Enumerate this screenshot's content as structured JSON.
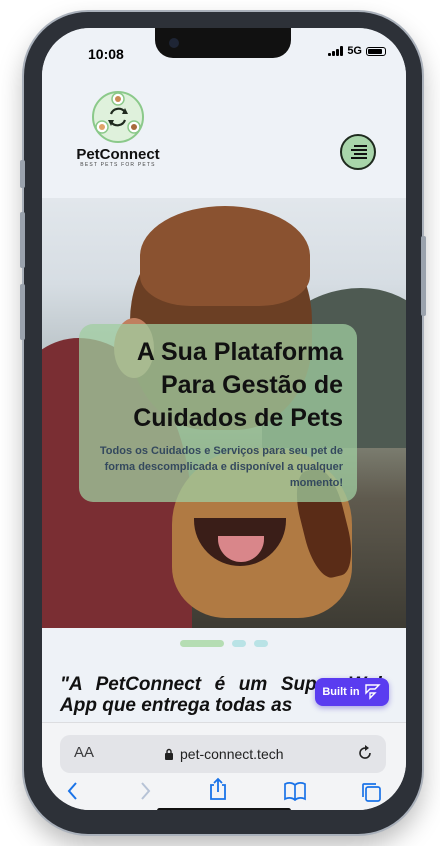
{
  "status_bar": {
    "time": "10:08",
    "network": "5G"
  },
  "header": {
    "logo_name": "PetConnect",
    "logo_tagline": "BEST PETS FOR PETS",
    "menu_icon": "hamburger-menu-icon"
  },
  "hero": {
    "title": "A Sua Plataforma Para Gestão de Cuidados de Pets",
    "subtitle": "Todos os Cuidados e Serviços para seu pet de forma descomplicada e disponível a qualquer momento!",
    "slides": 3,
    "active_slide": 1
  },
  "quote": {
    "text": "\"A PetConnect é um Super Web App que entrega todas as"
  },
  "badge": {
    "label": "Built in"
  },
  "browser": {
    "aa_label": "AA",
    "url": "pet-connect.tech",
    "toolbar": [
      "back-icon",
      "forward-icon",
      "share-icon",
      "bookmarks-icon",
      "tabs-icon"
    ]
  },
  "colors": {
    "accent_green": "#a8d5aa",
    "badge_purple": "#5a3cf0",
    "ios_blue": "#1a73e8"
  }
}
